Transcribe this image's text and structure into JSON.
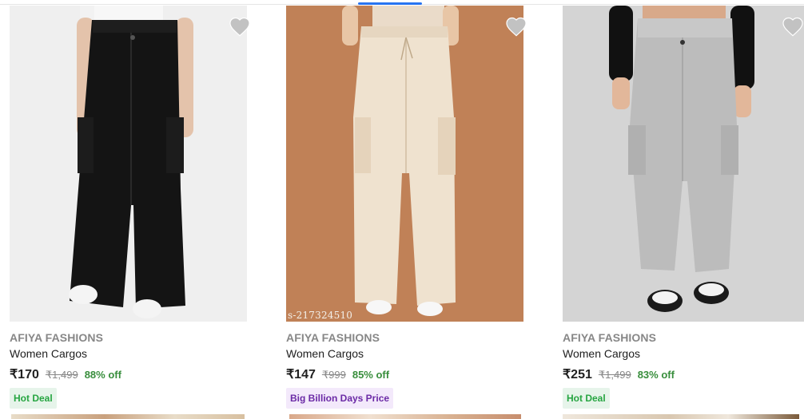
{
  "products": [
    {
      "brand": "AFIYA FASHIONS",
      "title": "Women Cargos",
      "price": "₹170",
      "mrp": "₹1,499",
      "discount": "88% off",
      "badge": "Hot Deal",
      "watermark": "",
      "image_icon": "black-cargo-pants-image"
    },
    {
      "brand": "AFIYA FASHIONS",
      "title": "Women Cargos",
      "price": "₹147",
      "mrp": "₹999",
      "discount": "85% off",
      "badge": "Big Billion Days Price",
      "watermark": "s-217324510",
      "image_icon": "beige-cargo-pants-image"
    },
    {
      "brand": "AFIYA FASHIONS",
      "title": "Women Cargos",
      "price": "₹251",
      "mrp": "₹1,499",
      "discount": "83% off",
      "badge": "Hot Deal",
      "watermark": "",
      "image_icon": "grey-cargo-pants-image"
    }
  ],
  "icons": {
    "wishlist": "heart-icon"
  },
  "colors": {
    "discount": "#388e3c",
    "hot_deal_bg": "#e6f4ea",
    "hot_deal_text": "#26a541",
    "bbd_bg": "#f3e9fb",
    "bbd_text": "#6b2aa6",
    "wishlist_heart": "#c2c2c2"
  }
}
